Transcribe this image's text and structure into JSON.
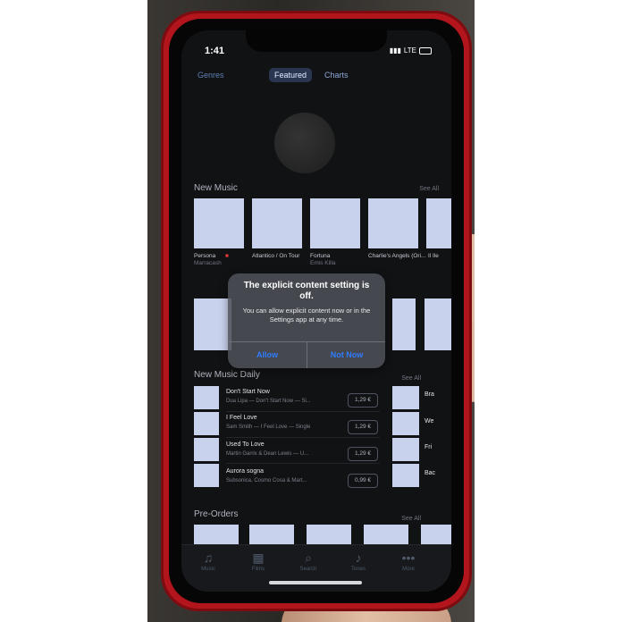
{
  "status": {
    "time": "1:41",
    "carrier": "LTE"
  },
  "segments": {
    "genres": "Genres",
    "featured": "Featured",
    "charts": "Charts"
  },
  "new_music": {
    "title": "New Music",
    "see_all": "See All",
    "albums": [
      {
        "title": "Persona",
        "artist": "Marracash",
        "explicit": true
      },
      {
        "title": "Atlantico / On Tour",
        "artist": ""
      },
      {
        "title": "Fortuna",
        "artist": "Emis Killa"
      },
      {
        "title": "Charlie's Angels (Ori...",
        "artist": ""
      },
      {
        "title": "Il Ile",
        "artist": ""
      }
    ]
  },
  "alert": {
    "title": "The explicit content setting is off.",
    "message": "You can allow explicit content now or in the Settings app at any time.",
    "allow": "Allow",
    "not_now": "Not Now"
  },
  "new_music_daily": {
    "title": "New Music Daily",
    "see_all": "See All",
    "songs": [
      {
        "title": "Don't Start Now",
        "subtitle": "Dua Lipa — Don't Start Now — Si...",
        "price": "1,29 €"
      },
      {
        "title": "I Feel Love",
        "subtitle": "Sam Smith — I Feel Love — Single",
        "price": "1,29 €"
      },
      {
        "title": "Used To Love",
        "subtitle": "Martin Garrix & Dean Lewis — U...",
        "price": "1,29 €"
      },
      {
        "title": "Aurora sogna",
        "subtitle": "Subsonica, Cosmo Cosa & Mart...",
        "price": "0,99 €"
      }
    ],
    "side_titles": [
      "Bra",
      "We",
      "Fri",
      "Bac"
    ]
  },
  "pre_orders": {
    "title": "Pre-Orders",
    "see_all": "See All"
  },
  "tabs": [
    {
      "label": "Music",
      "icon": "music-note-icon"
    },
    {
      "label": "Films",
      "icon": "film-icon"
    },
    {
      "label": "Search",
      "icon": "search-icon"
    },
    {
      "label": "Tones",
      "icon": "bell-icon"
    },
    {
      "label": "More",
      "icon": "more-icon"
    }
  ],
  "colors": {
    "phone_case": "#b3151c",
    "alert_button": "#2f7cff",
    "tile": "#c9d2ed"
  }
}
